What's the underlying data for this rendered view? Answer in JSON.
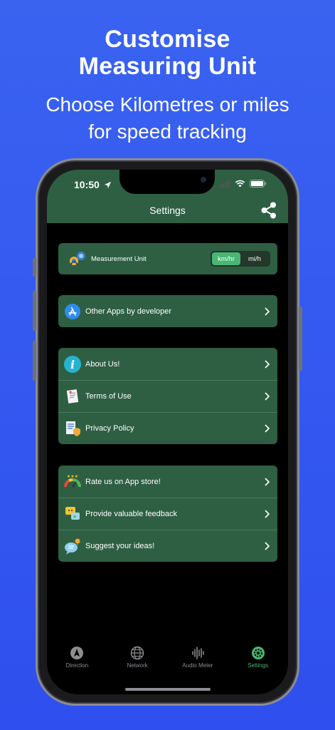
{
  "promo": {
    "headline_line1": "Customise",
    "headline_line2": "Measuring Unit",
    "subline_line1": "Choose Kilometres or miles",
    "subline_line2": "for speed tracking"
  },
  "status_bar": {
    "time": "10:50"
  },
  "nav": {
    "title": "Settings"
  },
  "measurement": {
    "label": "Measurement Unit",
    "options": [
      "km/hr",
      "mi/h"
    ],
    "selected": "km/hr"
  },
  "groups": {
    "apps": [
      {
        "label": "Other Apps by developer",
        "icon": "app-store-icon"
      }
    ],
    "info": [
      {
        "label": "About Us!",
        "icon": "info-icon"
      },
      {
        "label": "Terms of Use",
        "icon": "terms-document-icon"
      },
      {
        "label": "Privacy Policy",
        "icon": "privacy-policy-icon"
      }
    ],
    "feedback": [
      {
        "label": "Rate us on App store!",
        "icon": "rating-gauge-icon"
      },
      {
        "label": "Provide valuable feedback",
        "icon": "feedback-chat-icon"
      },
      {
        "label": "Suggest your ideas!",
        "icon": "idea-bubble-icon"
      }
    ]
  },
  "tabs": [
    {
      "label": "Direction",
      "icon": "compass-icon"
    },
    {
      "label": "Network",
      "icon": "globe-icon"
    },
    {
      "label": "Audio Meter",
      "icon": "waveform-icon"
    },
    {
      "label": "Settings",
      "icon": "gear-icon",
      "active": true
    }
  ],
  "colors": {
    "background": "#3458f0",
    "nav": "#2e5f43",
    "accent": "#47b870",
    "inactive_tab": "#8d8d92"
  }
}
